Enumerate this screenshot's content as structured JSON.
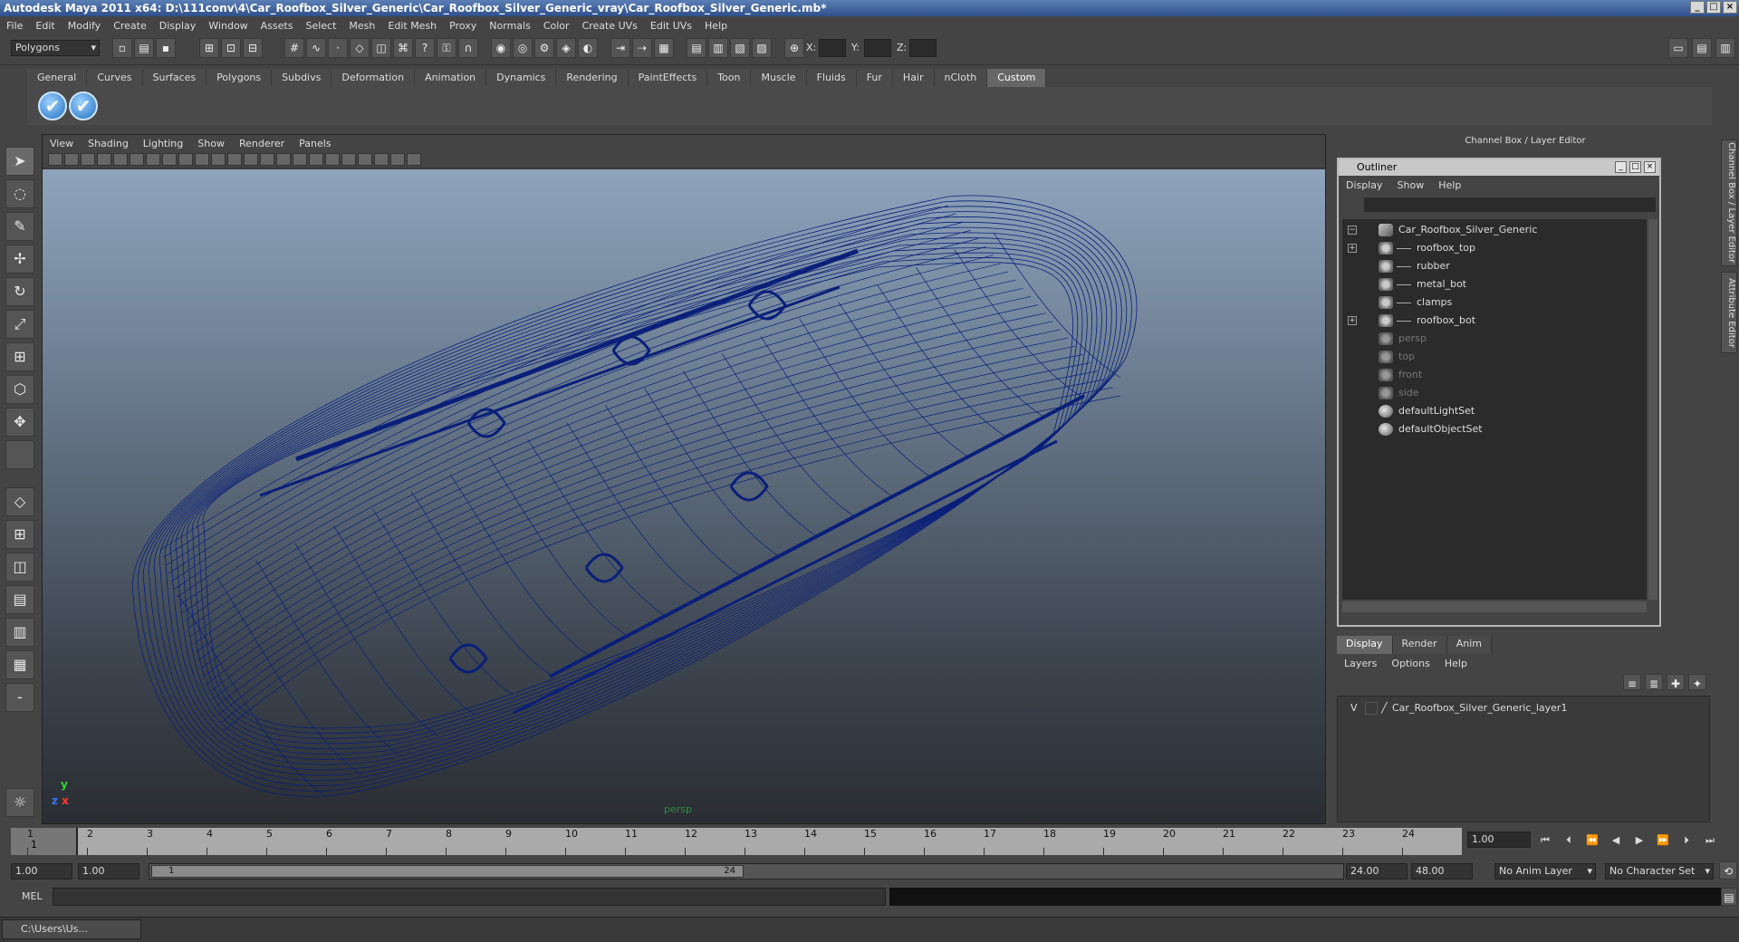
{
  "window": {
    "title": "Autodesk Maya 2011 x64: D:\\111conv\\4\\Car_Roofbox_Silver_Generic\\Car_Roofbox_Silver_Generic_vray\\Car_Roofbox_Silver_Generic.mb*",
    "min": "_",
    "max": "□",
    "close": "×"
  },
  "menubar": [
    "File",
    "Edit",
    "Modify",
    "Create",
    "Display",
    "Window",
    "Assets",
    "Select",
    "Mesh",
    "Edit Mesh",
    "Proxy",
    "Normals",
    "Color",
    "Create UVs",
    "Edit UVs",
    "Help"
  ],
  "statusline": {
    "mode": "Polygons",
    "x_label": "X:",
    "y_label": "Y:",
    "z_label": "Z:"
  },
  "shelf": {
    "tabs": [
      "General",
      "Curves",
      "Surfaces",
      "Polygons",
      "Subdivs",
      "Deformation",
      "Animation",
      "Dynamics",
      "Rendering",
      "PaintEffects",
      "Toon",
      "Muscle",
      "Fluids",
      "Fur",
      "Hair",
      "nCloth",
      "Custom"
    ],
    "active_tab": "Custom",
    "check_icon": "✔"
  },
  "viewport": {
    "menu": [
      "View",
      "Shading",
      "Lighting",
      "Show",
      "Renderer",
      "Panels"
    ],
    "camera_label": "persp",
    "axis_y": "y",
    "axis_x": "x",
    "axis_z": "z",
    "wire_color": "#0a1f7a"
  },
  "channelbox": {
    "title": "Channel Box / Layer Editor"
  },
  "outliner": {
    "title": "Outliner",
    "menu": [
      "Display",
      "Show",
      "Help"
    ],
    "items": [
      {
        "label": "Car_Roofbox_Silver_Generic",
        "expander": "−",
        "icon": "grp",
        "indent": 0,
        "dim": false
      },
      {
        "label": "roofbox_top",
        "expander": "+",
        "icon": "mesh",
        "indent": 1,
        "dim": false
      },
      {
        "label": "rubber",
        "expander": "",
        "icon": "mesh",
        "indent": 1,
        "dim": false
      },
      {
        "label": "metal_bot",
        "expander": "",
        "icon": "mesh",
        "indent": 1,
        "dim": false
      },
      {
        "label": "clamps",
        "expander": "",
        "icon": "mesh",
        "indent": 1,
        "dim": false
      },
      {
        "label": "roofbox_bot",
        "expander": "+",
        "icon": "mesh",
        "indent": 1,
        "dim": false
      },
      {
        "label": "persp",
        "expander": "",
        "icon": "cam",
        "indent": 0,
        "dim": true
      },
      {
        "label": "top",
        "expander": "",
        "icon": "cam",
        "indent": 0,
        "dim": true
      },
      {
        "label": "front",
        "expander": "",
        "icon": "cam",
        "indent": 0,
        "dim": true
      },
      {
        "label": "side",
        "expander": "",
        "icon": "cam",
        "indent": 0,
        "dim": true
      },
      {
        "label": "defaultLightSet",
        "expander": "",
        "icon": "set",
        "indent": 0,
        "dim": false
      },
      {
        "label": "defaultObjectSet",
        "expander": "",
        "icon": "set",
        "indent": 0,
        "dim": false
      }
    ]
  },
  "layers": {
    "tabs": [
      "Display",
      "Render",
      "Anim"
    ],
    "active_tab": "Display",
    "menu": [
      "Layers",
      "Options",
      "Help"
    ],
    "rows": [
      {
        "visible": "V",
        "name": "Car_Roofbox_Silver_Generic_layer1"
      }
    ]
  },
  "side_tabs": [
    "Channel Box / Layer Editor",
    "Attribute Editor"
  ],
  "timeline": {
    "ticks": [
      "1",
      "2",
      "3",
      "4",
      "5",
      "6",
      "7",
      "8",
      "9",
      "10",
      "11",
      "12",
      "13",
      "14",
      "15",
      "16",
      "17",
      "18",
      "19",
      "20",
      "21",
      "22",
      "23",
      "24"
    ],
    "current_frame": "1",
    "current_frame_field": "1.00"
  },
  "range": {
    "start": "1.00",
    "start_inner": "1.00",
    "slider_start": "1",
    "slider_end": "24",
    "end_inner": "24.00",
    "end": "48.00",
    "anim_layer": "No Anim Layer",
    "character_set": "No Character Set"
  },
  "cmdline": {
    "label": "MEL"
  },
  "taskbar": {
    "item": "C:\\Users\\Us..."
  }
}
